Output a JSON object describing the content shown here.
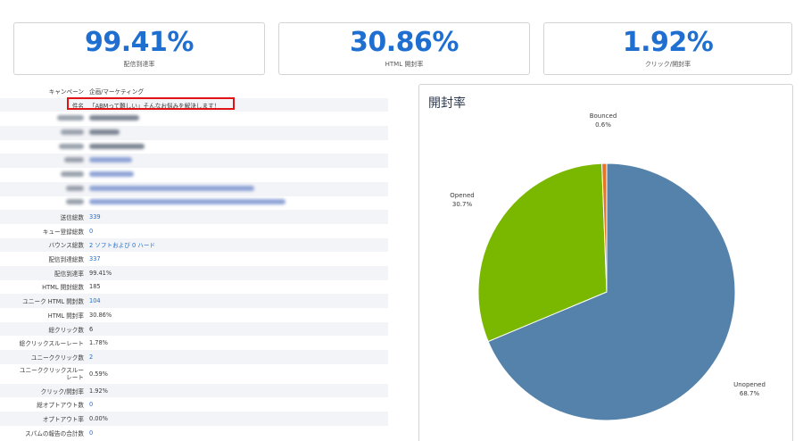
{
  "kpis": [
    {
      "value": "99.41%",
      "label": "配信到達率"
    },
    {
      "value": "30.86%",
      "label": "HTML 開封率"
    },
    {
      "value": "1.92%",
      "label": "クリック/開封率"
    }
  ],
  "details": {
    "campaign_label": "キャンペーン",
    "campaign_value": "企画/マーケティング",
    "subject_label": "件名",
    "subject_value": "「ABMって難しい」そんなお悩みを解決します！",
    "stats": [
      {
        "label": "送信総数",
        "value": "339",
        "link": true
      },
      {
        "label": "キュー登録総数",
        "value": "0",
        "link": true
      },
      {
        "label": "バウンス総数",
        "value": "2 ソフトおよび 0 ハード",
        "link": true
      },
      {
        "label": "配信到達総数",
        "value": "337",
        "link": true
      },
      {
        "label": "配信到達率",
        "value": "99.41%",
        "link": false
      },
      {
        "label": "HTML 開封総数",
        "value": "185",
        "link": false
      },
      {
        "label": "ユニーク HTML 開封数",
        "value": "104",
        "link": true
      },
      {
        "label": "HTML 開封率",
        "value": "30.86%",
        "link": false
      },
      {
        "label": "総クリック数",
        "value": "6",
        "link": false
      },
      {
        "label": "総クリックスルーレート",
        "value": "1.78%",
        "link": false
      },
      {
        "label": "ユニーククリック数",
        "value": "2",
        "link": true
      },
      {
        "label": "ユニーククリックスルーレート",
        "value": "0.59%",
        "link": false
      },
      {
        "label": "クリック/開封率",
        "value": "1.92%",
        "link": false
      },
      {
        "label": "総オプトアウト数",
        "value": "0",
        "link": true
      },
      {
        "label": "オプトアウト率",
        "value": "0.00%",
        "link": false
      },
      {
        "label": "スパムの報告の合計数",
        "value": "0",
        "link": true
      }
    ]
  },
  "chart": {
    "title": "開封率"
  },
  "colors": {
    "accent": "#1f6fd1",
    "unopened": "#5482ab",
    "opened": "#7ab800",
    "bounced": "#e5742b"
  },
  "chart_data": {
    "type": "pie",
    "categories": [
      "Unopened",
      "Opened",
      "Bounced"
    ],
    "values": [
      68.7,
      30.7,
      0.6
    ],
    "labels": [
      "68.7%",
      "30.7%",
      "0.6%"
    ],
    "title": "開封率"
  }
}
